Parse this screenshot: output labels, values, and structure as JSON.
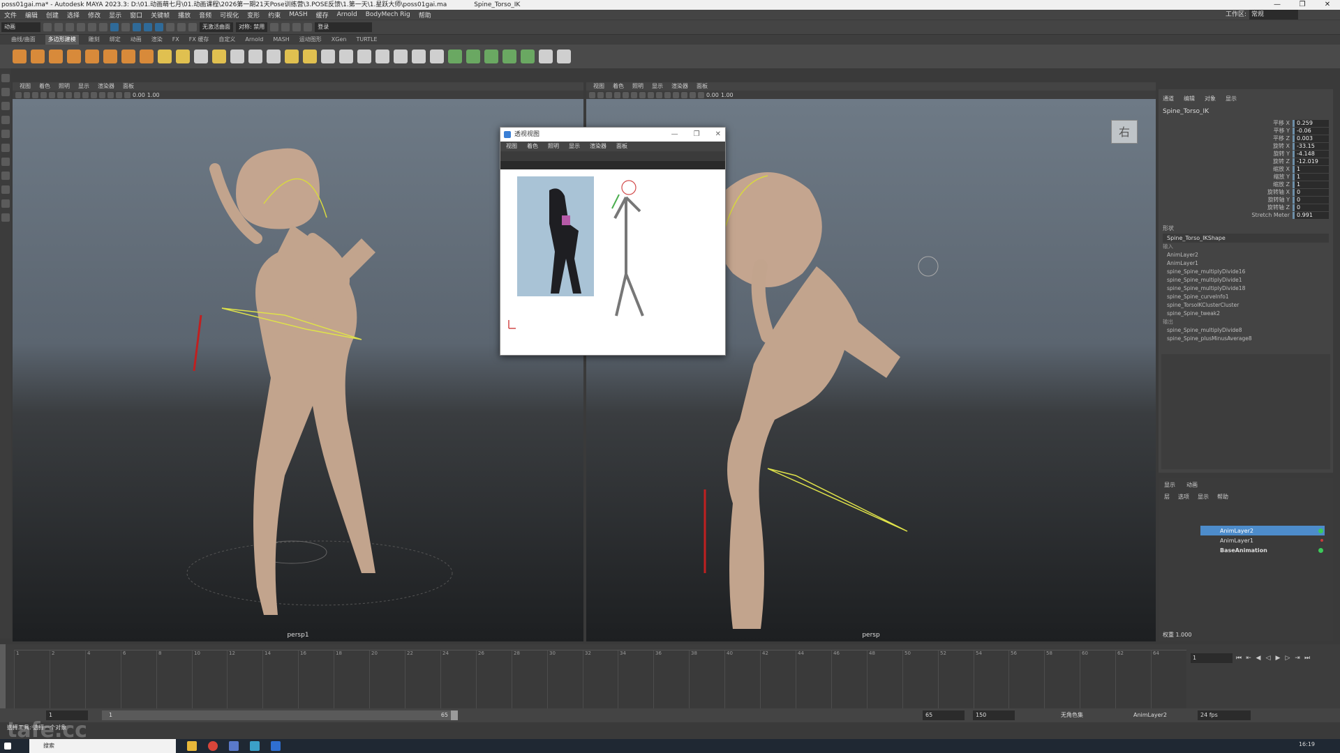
{
  "window": {
    "title": "poss01gai.ma* - Autodesk MAYA 2023.3: D:\\01.动画萌七月\\01.动画课程\\2026第一期21天Pose训练营\\3.POSE反馈\\1.第一天\\1.星跃大师\\poss01gai.ma",
    "selected_node": "Spine_Torso_IK",
    "controls": [
      "—",
      "❐",
      "✕"
    ]
  },
  "menubar": {
    "items": [
      "文件",
      "编辑",
      "创建",
      "选择",
      "修改",
      "显示",
      "窗口",
      "关键帧",
      "播放",
      "音频",
      "可视化",
      "变形",
      "约束",
      "MASH",
      "缓存",
      "Arnold",
      "BodyMech Rig",
      "帮助"
    ],
    "workspace_label": "工作区:",
    "workspace_value": "常规"
  },
  "statusline": {
    "mode": "动画",
    "live_surface": "无激活曲面",
    "symmetry": "对称: 禁用",
    "login": "登录"
  },
  "shelf": {
    "tabs": [
      "曲线/曲面",
      "多边形建模",
      "雕刻",
      "绑定",
      "动画",
      "渲染",
      "FX",
      "FX 缓存",
      "自定义",
      "Arnold",
      "MASH",
      "运动图形",
      "XGen",
      "TURTLE"
    ],
    "active_tab": "多边形建模"
  },
  "viewports": {
    "menu": [
      "视图",
      "着色",
      "照明",
      "显示",
      "渲染器",
      "面板"
    ],
    "left": {
      "camera": "persp1",
      "time": "0.00",
      "gamma": "1.00"
    },
    "right": {
      "camera": "persp",
      "time": "0.00",
      "gamma": "1.00",
      "view_cube": "右"
    }
  },
  "float_window": {
    "title": "透视视图",
    "menu": [
      "视图",
      "着色",
      "照明",
      "显示",
      "渲染器",
      "面板"
    ]
  },
  "channel_box": {
    "tabs": [
      "通道",
      "编辑",
      "对象",
      "显示"
    ],
    "node": "Spine_Torso_IK",
    "attributes": [
      {
        "name": "平移 X",
        "value": "0.259"
      },
      {
        "name": "平移 Y",
        "value": "-0.06"
      },
      {
        "name": "平移 Z",
        "value": "0.003"
      },
      {
        "name": "旋转 X",
        "value": "-33.15"
      },
      {
        "name": "旋转 Y",
        "value": "-4.148"
      },
      {
        "name": "旋转 Z",
        "value": "-12.019"
      },
      {
        "name": "缩放 X",
        "value": "1"
      },
      {
        "name": "缩放 Y",
        "value": "1"
      },
      {
        "name": "缩放 Z",
        "value": "1"
      },
      {
        "name": "旋转轴 X",
        "value": "0"
      },
      {
        "name": "旋转轴 Y",
        "value": "0"
      },
      {
        "name": "旋转轴 Z",
        "value": "0"
      },
      {
        "name": "Stretch Meter",
        "value": "0.991"
      }
    ],
    "shapes_header": "形状",
    "shape_name": "Spine_Torso_IKShape",
    "inputs_header": "输入",
    "inputs": [
      "AnimLayer2",
      "AnimLayer1",
      "spine_Spine_multiplyDivide16",
      "spine_Spine_multiplyDivide1",
      "spine_Spine_multiplyDivide18",
      "spine_Spine_curveInfo1",
      "spine_TorsoIKClusterCluster",
      "spine_Spine_tweak2"
    ],
    "outputs_header": "输出",
    "outputs": [
      "spine_Spine_multiplyDivide8",
      "spine_Spine_plusMinusAverage8"
    ]
  },
  "layer_editor": {
    "tabs": [
      "显示",
      "动画"
    ],
    "menu": [
      "层",
      "选项",
      "显示",
      "帮助"
    ],
    "layers": [
      {
        "name": "AnimLayer2",
        "active": true
      },
      {
        "name": "AnimLayer1",
        "active": false
      },
      {
        "name": "BaseAnimation",
        "active": false
      }
    ],
    "weight_label": "权重",
    "weight_value": "1.000"
  },
  "timeline": {
    "ticks": [
      "1",
      "2",
      "4",
      "6",
      "8",
      "10",
      "12",
      "14",
      "16",
      "18",
      "20",
      "22",
      "24",
      "26",
      "28",
      "30",
      "32",
      "34",
      "36",
      "38",
      "40",
      "42",
      "44",
      "46",
      "48",
      "50",
      "52",
      "54",
      "56",
      "58",
      "60",
      "62",
      "64"
    ],
    "current_frame": "1"
  },
  "range": {
    "start": "1",
    "slider_start": "1",
    "slider_end": "65",
    "end": "65",
    "anim_end": "150",
    "character_set": "无角色集",
    "anim_layer": "AnimLayer2",
    "fps": "24 fps"
  },
  "cmdline": {
    "text": "选择工具: 选择一个对象"
  },
  "watermark": "tafe.cc",
  "taskbar": {
    "search": "搜索",
    "clock": "16:19"
  }
}
